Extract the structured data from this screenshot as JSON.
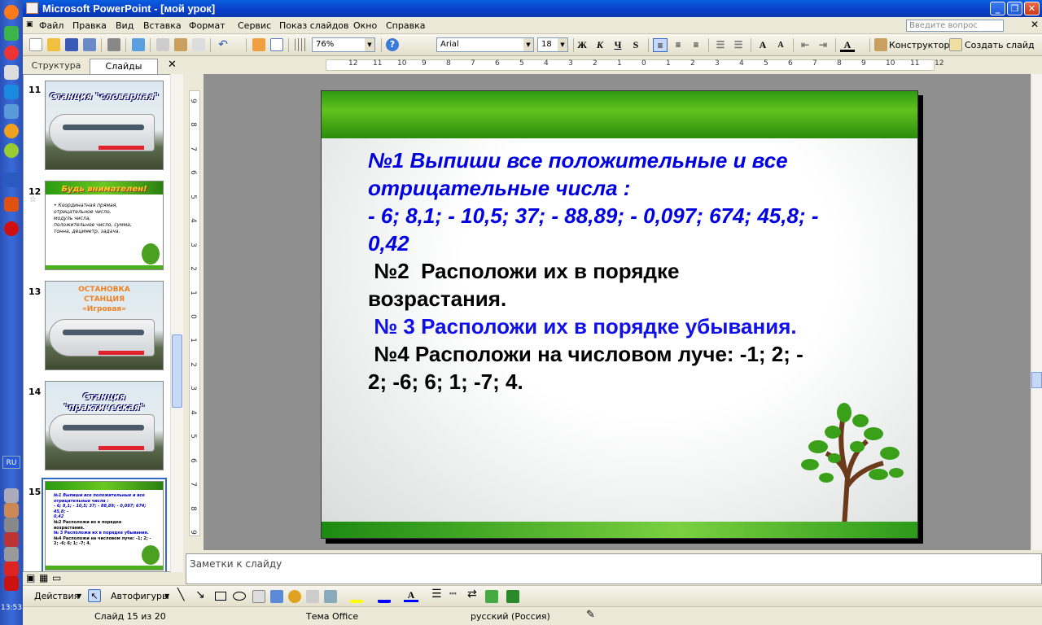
{
  "window": {
    "title": "Microsoft PowerPoint - [мой урок]"
  },
  "menu": [
    "Файл",
    "Правка",
    "Вид",
    "Вставка",
    "Формат",
    "Сервис",
    "Показ слайдов",
    "Окно",
    "Справка"
  ],
  "ask_placeholder": "Введите вопрос",
  "toolbar": {
    "zoom": "76%",
    "font": "Arial",
    "font_size": "18",
    "bold": "Ж",
    "italic": "К",
    "underline": "Ч",
    "shadow": "S",
    "designer": "Конструктор",
    "new_slide": "Создать слайд"
  },
  "tabs": {
    "structure": "Структура",
    "slides": "Слайды"
  },
  "thumbnails": [
    {
      "num": "11",
      "title": "Станция \"словарная\"",
      "kind": "train"
    },
    {
      "num": "12",
      "title": "Будь внимателен!",
      "kind": "text",
      "lines": [
        "• Координатная прямая,",
        "отрицательное число,",
        "модуль числа,",
        "положительное число, сумма,",
        "тонна, дециметр, задача."
      ]
    },
    {
      "num": "13",
      "title": "ОСТАНОВКА СТАНЦИЯ «Игровая»",
      "kind": "train"
    },
    {
      "num": "14",
      "title": "Станция \"практическая\"",
      "kind": "train"
    },
    {
      "num": "15",
      "title": "",
      "kind": "text",
      "lines": [
        "№1 Выпиши все положительные и все",
        "отрицательные числа :",
        "- 6; 8,1; - 10,5; 37; - 88,89; - 0,097; 674; 45,8; -",
        "0,42",
        "№2 Расположи их в порядке",
        "возрастания.",
        "№ 3 Расположи их в порядке убывания.",
        "№4 Расположи на числовом луче: -1; 2; -",
        "2; -6; 6; 1; -7; 4."
      ]
    }
  ],
  "hruler": [
    "12",
    "11",
    "10",
    "9",
    "8",
    "7",
    "6",
    "5",
    "4",
    "3",
    "2",
    "1",
    "0",
    "1",
    "2",
    "3",
    "4",
    "5",
    "6",
    "7",
    "8",
    "9",
    "10",
    "11",
    "12"
  ],
  "vruler": [
    "9",
    "8",
    "7",
    "6",
    "5",
    "4",
    "3",
    "2",
    "1",
    "0",
    "1",
    "2",
    "3",
    "4",
    "5",
    "6",
    "7",
    "8",
    "9"
  ],
  "slide": {
    "line1": "№1 Выпиши все положительные и все",
    "line2": "отрицательные числа :",
    "line3": "- 6; 8,1; - 10,5; 37; - 88,89; - 0,097; 674; 45,8; -",
    "line4": "0,42",
    "line5": " №2  Расположи их в порядке",
    "line6": "возрастания.",
    "line7": " № 3 Расположи их в порядке убывания.",
    "line8": " №4 Расположи на числовом луче: -1; 2; -",
    "line9": "2; -6; 6; 1; -7; 4."
  },
  "notes_placeholder": "Заметки к слайду",
  "drawbar": {
    "actions": "Действия",
    "autoshapes": "Автофигуры"
  },
  "status": {
    "slide": "Слайд 15 из 20",
    "theme": "Тема Office",
    "language": "русский (Россия)"
  },
  "taskbar": {
    "lang": "RU",
    "clock": "13:53"
  },
  "colors": {
    "title_bar": "#0a4fd8",
    "slide_blue": "#0000e0",
    "slide_green": "#2e9a12"
  }
}
